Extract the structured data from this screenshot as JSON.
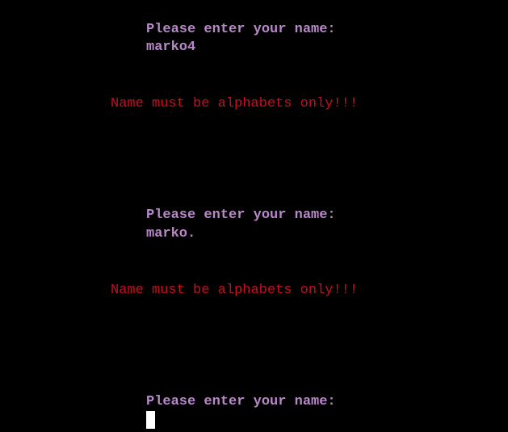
{
  "terminal": {
    "entries": [
      {
        "prompt": "Please enter your name:",
        "input": "marko4",
        "error": "Name must be alphabets only!!!"
      },
      {
        "prompt": "Please enter your name:",
        "input": "marko.",
        "error": "Name must be alphabets only!!!"
      },
      {
        "prompt": "Please enter your name:",
        "input": ""
      }
    ]
  },
  "colors": {
    "background": "#000000",
    "prompt_text": "#b988c9",
    "error_text": "#c50f1f",
    "cursor": "#ffffff"
  }
}
